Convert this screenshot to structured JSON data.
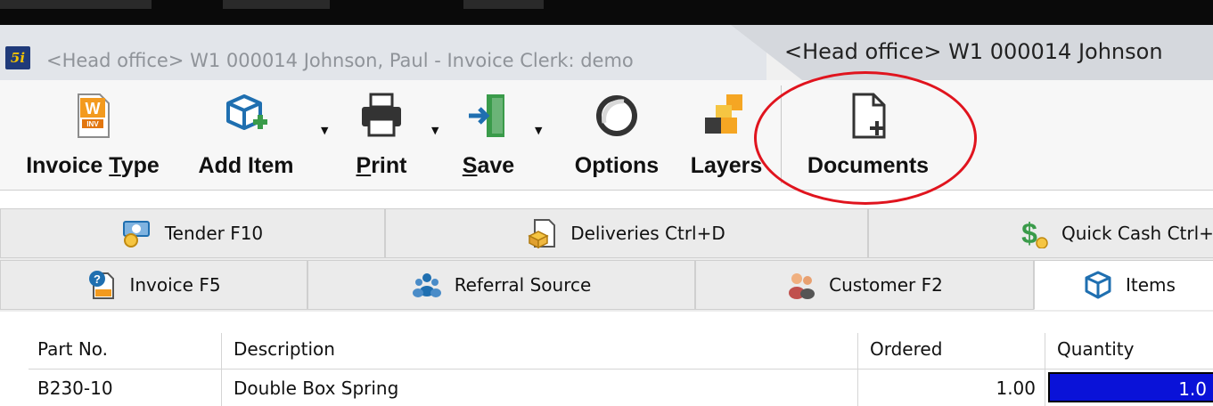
{
  "window": {
    "inactive_title": "<Head office> W1 000014 Johnson, Paul - Invoice Clerk: demo",
    "active_title": "<Head office> W1 000014 Johnson",
    "logo_text": "5i"
  },
  "toolbar": {
    "invoice_type": {
      "pre": "Invoice ",
      "ul": "T",
      "post": "ype"
    },
    "add_item": {
      "label": "Add Item"
    },
    "print": {
      "ul": "P",
      "post": "rint"
    },
    "save": {
      "ul": "S",
      "post": "ave"
    },
    "options": {
      "label": "Options"
    },
    "layers": {
      "label": "Layers"
    },
    "documents": {
      "label": "Documents"
    },
    "dropdown_glyph": "▼"
  },
  "tabs": {
    "row1": [
      {
        "label": "Tender F10"
      },
      {
        "label": "Deliveries Ctrl+D"
      },
      {
        "label": "Quick Cash Ctrl+"
      }
    ],
    "row2": [
      {
        "label": "Invoice F5"
      },
      {
        "label": "Referral Source"
      },
      {
        "label": "Customer F2"
      },
      {
        "label": "Items",
        "active": true
      }
    ]
  },
  "items_table": {
    "columns": [
      "Part No.",
      "Description",
      "Ordered",
      "Quantity"
    ],
    "rows": [
      {
        "part_no": "B230-10",
        "description": "Double Box Spring",
        "ordered": "1.00",
        "quantity": "1.0"
      }
    ]
  },
  "colors": {
    "highlight_circle": "#e0141e",
    "selected_field": "#0a12d8",
    "accent_green": "#3a9b4a",
    "accent_orange": "#f5a623",
    "icon_blue": "#1f6fb0"
  }
}
